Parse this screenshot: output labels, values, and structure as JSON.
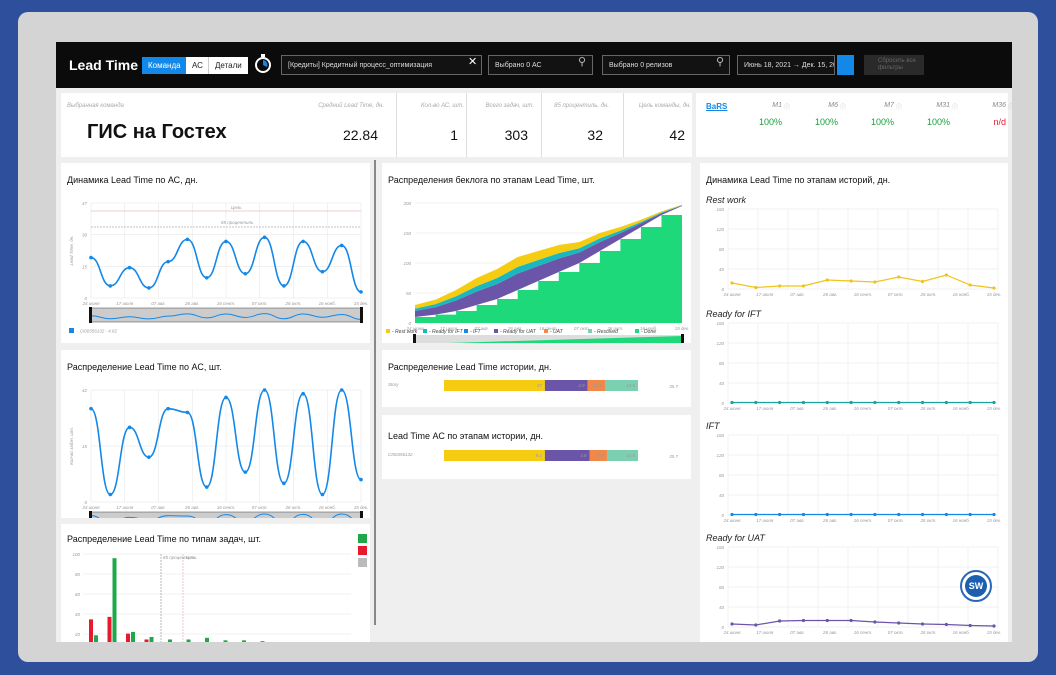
{
  "header": {
    "title": "Lead Time",
    "tabs": [
      "Команда",
      "АС",
      "Детали"
    ],
    "search_value": "[Кредиты] Кредитный процесс_оптимизация",
    "as_filter": "Выбрано 0 АС",
    "release_filter": "Выбрано 0 релизов",
    "date_range": "Июнь 18, 2021 → Дек. 15, 2021",
    "reset_label": "Сбросить все фильтры",
    "accent": "#1488e8"
  },
  "summary": {
    "team_label": "Выбранная команда",
    "team_name": "ГИС на Гостех",
    "stats": [
      {
        "label": "Средний Lead Time, дн.",
        "value": "22.84"
      },
      {
        "label": "Кол-во АС, шт.",
        "value": "1"
      },
      {
        "label": "Всего задач, шт.",
        "value": "303"
      },
      {
        "label": "85 процентиль, дн.",
        "value": "32"
      },
      {
        "label": "Цель команды, дн.",
        "value": "42"
      }
    ]
  },
  "metrics": {
    "link": "BaRS",
    "items": [
      {
        "label": "M1",
        "value": "100%"
      },
      {
        "label": "M6",
        "value": "100%"
      },
      {
        "label": "M7",
        "value": "100%"
      },
      {
        "label": "M31",
        "value": "100%"
      },
      {
        "label": "M36",
        "value": "n/d"
      }
    ]
  },
  "ticks": [
    "24 июня",
    "17 июля",
    "07 авг.",
    "26 авг.",
    "16 сент.",
    "07 окт.",
    "26 окт.",
    "16 нояб.",
    "15 дек."
  ],
  "chart1": {
    "title": "Динамика Lead Time по АС, дн.",
    "ylabel": "Lead Time, дн.",
    "yticks": [
      "47",
      "30",
      "15",
      "0"
    ],
    "goal_label": "Цель",
    "p85_label": "85 процентиль",
    "legend": "- CI00356132 - 4.82",
    "values": [
      20,
      6,
      15,
      5,
      18,
      29,
      10,
      28,
      12,
      30,
      6,
      28,
      13,
      26,
      3
    ]
  },
  "chart2": {
    "title": "Распределение Lead Time по АС, шт.",
    "ylabel": "Кол-во задач, шт.",
    "yticks": [
      "42",
      "15",
      "0"
    ],
    "values": [
      25,
      2,
      20,
      12,
      25,
      24,
      4,
      28,
      8,
      30,
      5,
      29,
      2,
      30,
      6
    ]
  },
  "chart3": {
    "title": "Распределение Lead Time по типам задач, шт.",
    "yticks": [
      "100",
      "80",
      "60",
      "40",
      "20"
    ],
    "p85_label": "85 процентиль",
    "goal_label": "Цель",
    "red": [
      27,
      30,
      10,
      3,
      0,
      0,
      0,
      0,
      0,
      0
    ],
    "green": [
      8,
      100,
      12,
      6,
      3,
      3,
      5,
      2,
      2,
      1
    ]
  },
  "backlog": {
    "title": "Распределения беклога по этапам Lead Time, шт.",
    "yticks": [
      "200",
      "150",
      "100",
      "50",
      "0"
    ],
    "legend": [
      "- Rest work",
      "- Ready for IFT",
      "- IFT",
      "- Ready for UAT",
      "- UAT",
      "- Resolved",
      "- Done"
    ],
    "colors": [
      "#f6cc12",
      "#1ab7bf",
      "#1488e8",
      "#6b55a8",
      "#f2874a",
      "#7ad0b0",
      "#1ed97a"
    ],
    "done": [
      10,
      14,
      20,
      30,
      40,
      55,
      70,
      85,
      100,
      120,
      140,
      160,
      180,
      195
    ],
    "other": [
      20,
      25,
      35,
      45,
      50,
      55,
      50,
      45,
      35,
      30,
      20,
      12,
      6,
      2
    ]
  },
  "story": {
    "title": "Распределение Lead Time истории, дн.",
    "row": "Story",
    "segments": [
      "47",
      "4.9",
      "12.8",
      "13.5"
    ],
    "total": "35.7"
  },
  "asstage": {
    "title": "Lead Time АС по этапам истории, дн.",
    "row": "CI00356132",
    "segments": [
      "8.1",
      "3.8",
      "9.7",
      "22.5"
    ],
    "total": "35.7"
  },
  "stages": {
    "title": "Динамика Lead Time по этапам историй, дн.",
    "yticks": [
      "160",
      "120",
      "80",
      "40",
      "0"
    ],
    "panels": [
      {
        "name": "Rest work",
        "color": "#f0c419",
        "values": [
          12,
          3,
          6,
          6,
          18,
          16,
          14,
          24,
          15,
          28,
          8,
          2
        ]
      },
      {
        "name": "Ready for IFT",
        "color": "#17a59c",
        "values": [
          1,
          1,
          1,
          1,
          1,
          1,
          1,
          1,
          1,
          1,
          1,
          1
        ]
      },
      {
        "name": "IFT",
        "color": "#1488e8",
        "values": [
          1,
          1,
          1,
          1,
          1,
          1,
          1,
          1,
          1,
          1,
          1,
          1
        ]
      },
      {
        "name": "Ready for UAT",
        "color": "#6b55a8",
        "values": [
          6,
          4,
          12,
          13,
          13,
          13,
          10,
          8,
          6,
          5,
          3,
          2
        ]
      }
    ]
  },
  "badge": "SW"
}
